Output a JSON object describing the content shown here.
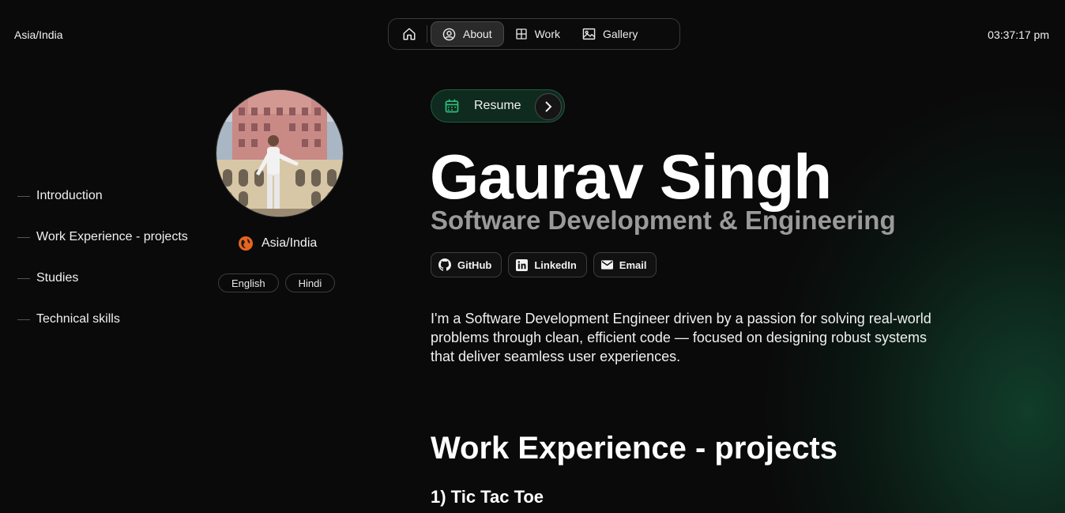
{
  "header": {
    "timezone": "Asia/India",
    "time": "03:37:17 pm"
  },
  "nav": {
    "home_icon": "home-icon",
    "items": [
      {
        "label": "About",
        "icon": "person-circle-icon",
        "active": true
      },
      {
        "label": "Work",
        "icon": "grid-icon",
        "active": false
      },
      {
        "label": "Gallery",
        "icon": "image-icon",
        "active": false
      }
    ]
  },
  "toc": [
    {
      "label": "Introduction"
    },
    {
      "label": "Work Experience - projects"
    },
    {
      "label": "Studies"
    },
    {
      "label": "Technical skills"
    }
  ],
  "profile": {
    "location": "Asia/India",
    "languages": [
      "English",
      "Hindi"
    ]
  },
  "resume": {
    "label": "Resume",
    "icon": "calendar-icon"
  },
  "hero": {
    "name": "Gaurav Singh",
    "role": "Software Development & Engineering"
  },
  "socials": [
    {
      "label": "GitHub",
      "icon": "github-icon"
    },
    {
      "label": "LinkedIn",
      "icon": "linkedin-icon"
    },
    {
      "label": "Email",
      "icon": "mail-icon"
    }
  ],
  "bio": "I'm a Software Development Engineer driven by a passion for solving real-world problems through clean, efficient code — focused on designing robust systems that deliver seamless user experiences.",
  "work": {
    "title": "Work Experience - projects",
    "first_project": "1) Tic Tac Toe"
  },
  "colors": {
    "background": "#0a0a0a",
    "accent_green": "#1f5a3f",
    "globe_orange": "#e8641e"
  }
}
